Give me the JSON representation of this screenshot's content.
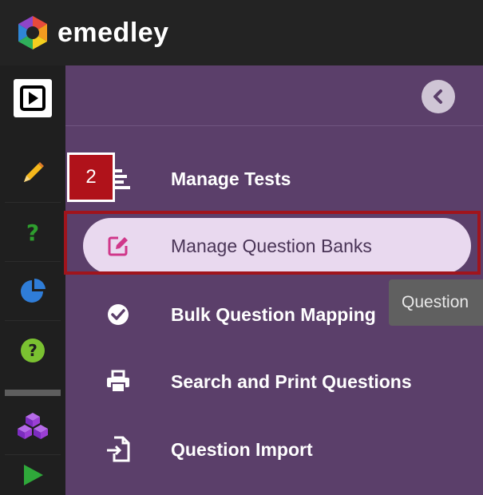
{
  "app": {
    "brand_name": "emedley"
  },
  "rail": {
    "items": [
      {
        "icon": "play-square-icon",
        "color": "#000000"
      },
      {
        "icon": "pencil-icon",
        "color": "#f5b81c"
      },
      {
        "icon": "question-mark-icon",
        "color": "#2e9e2e"
      },
      {
        "icon": "pie-chart-icon",
        "color": "#2f7dd8"
      },
      {
        "icon": "help-circle-icon",
        "color": "#7ac131"
      },
      {
        "icon": "cubes-icon",
        "color": "#9b3fd4"
      },
      {
        "icon": "play-triangle-icon",
        "color": "#2fa83a"
      }
    ]
  },
  "menu": {
    "items": [
      {
        "label": "Manage Tests",
        "icon": "list-lines-icon",
        "active": false
      },
      {
        "label": "Manage Question Banks",
        "icon": "edit-square-icon",
        "active": true
      },
      {
        "label": "Bulk Question Mapping",
        "icon": "check-circle-icon",
        "active": false
      },
      {
        "label": "Search and Print Questions",
        "icon": "printer-icon",
        "active": false
      },
      {
        "label": "Question Import",
        "icon": "file-import-icon",
        "active": false
      }
    ]
  },
  "annotation": {
    "step_number": "2"
  },
  "tooltip": {
    "text": "Question"
  },
  "colors": {
    "panel_bg": "#5b3f6a",
    "active_item_bg": "#e9d9ef",
    "highlight_red": "#a0141c",
    "accent_pink": "#d0378a"
  }
}
